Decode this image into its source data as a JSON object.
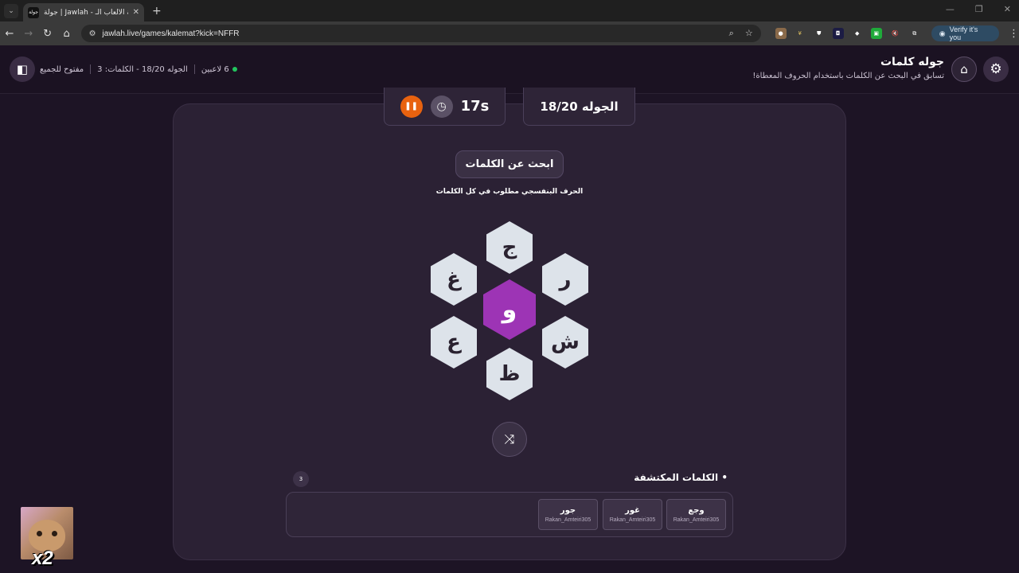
{
  "browser": {
    "tab_title": "جولة | Jawlah - منصة الألعاب الـ",
    "tab_favicon_text": "جولة",
    "url": "jawlah.live/games/kalemat?kick=NFFR",
    "verify_label": "Verify it's you"
  },
  "header": {
    "title": "جوله كلمات",
    "subtitle": "تسابق في البحث عن الكلمات باستخدام الحروف المعطاة!",
    "players": "6 لاعبين",
    "round_info": "الجوله 18/20 - الكلمات: 3",
    "open_status": "مفتوح للجميع"
  },
  "game": {
    "timer": "17s",
    "round": "الجوله 18/20",
    "search_label": "ابحث عن الكلمات",
    "hint": "الحرف البنفسجي مطلوب في كل الكلمات",
    "center_letter": "و",
    "letters": {
      "top": "ج",
      "top_left": "غ",
      "top_right": "ر",
      "bottom_left": "ع",
      "bottom_right": "ش",
      "bottom": "ظ"
    }
  },
  "found": {
    "title": "• الكلمات المكتشفة",
    "count": "3",
    "words": [
      {
        "word": "وجع",
        "player": "Rakan_Amteiri305"
      },
      {
        "word": "غور",
        "player": "Rakan_Amteiri305"
      },
      {
        "word": "جور",
        "player": "Rakan_Amteiri305"
      }
    ]
  },
  "overlay": {
    "multiplier": "x2"
  },
  "colors": {
    "accent_purple": "#9d34b5",
    "pause_orange": "#e8620f",
    "online_green": "#22c55e",
    "hex_tile": "#dde3ea"
  }
}
